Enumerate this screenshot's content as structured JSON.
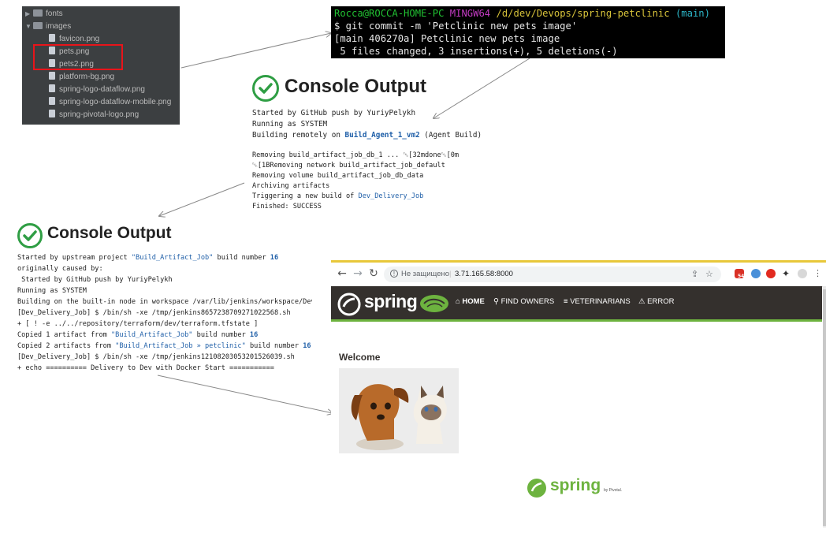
{
  "file_tree": {
    "items": [
      {
        "label": "fonts",
        "type": "folder",
        "expanded": false
      },
      {
        "label": "images",
        "type": "folder",
        "expanded": true
      },
      {
        "label": "favicon.png",
        "type": "file"
      },
      {
        "label": "pets.png",
        "type": "file",
        "highlighted": true
      },
      {
        "label": "pets2.png",
        "type": "file",
        "highlighted": true
      },
      {
        "label": "platform-bg.png",
        "type": "file"
      },
      {
        "label": "spring-logo-dataflow.png",
        "type": "file"
      },
      {
        "label": "spring-logo-dataflow-mobile.png",
        "type": "file"
      },
      {
        "label": "spring-pivotal-logo.png",
        "type": "file"
      }
    ],
    "highlight_color": "#e8141a"
  },
  "terminal": {
    "user_host": "Rocca@ROCCA-HOME-PC",
    "shell": "MINGW64",
    "path": "/d/dev/Devops/spring-petclinic",
    "branch": "(main)",
    "command": "$ git commit -m 'Petclinic new pets image'",
    "out1": "[main 406270a] Petclinic new pets image",
    "out2": " 5 files changed, 3 insertions(+), 5 deletions(-)"
  },
  "console1": {
    "title": "Console Output",
    "l1": "Started by GitHub push by YuriyPelykh",
    "l2": "Running as SYSTEM",
    "l3_pre": "Building remotely on ",
    "l3_link": "Build_Agent_1_vm2",
    "l3_post": " (Agent Build)",
    "l4": "Removing build_artifact_job_db_1 ... ␛[32mdone␛[0m",
    "l5": "␛[1BRemoving network build_artifact_job_default",
    "l6": "Removing volume build_artifact_job_db_data",
    "l7": "Archiving artifacts",
    "l8_pre": "Triggering a new build of ",
    "l8_link": "Dev_Delivery_Job",
    "l9": "Finished: SUCCESS"
  },
  "console2": {
    "title": "Console Output",
    "l1_pre": "Started by upstream project ",
    "l1_link": "\"Build_Artifact_Job\"",
    "l1_mid": " build number ",
    "l1_num": "16",
    "l2": "originally caused by:",
    "l3": " Started by GitHub push by YuriyPelykh",
    "l4": "Running as SYSTEM",
    "l5": "Building on the built-in node in workspace /var/lib/jenkins/workspace/Dev_",
    "l6": "[Dev_Delivery_Job] $ /bin/sh -xe /tmp/jenkins8657238709271022568.sh",
    "l7": "+ [ ! -e ../../repository/terraform/dev/terraform.tfstate ]",
    "l8_pre": "Copied 1 artifact from ",
    "l8_link": "\"Build_Artifact_Job\"",
    "l8_mid": " build number ",
    "l8_num": "16",
    "l9_pre": "Copied 2 artifacts from ",
    "l9_link": "\"Build_Artifact_Job » petclinic\"",
    "l9_mid": " build number ",
    "l9_num": "16",
    "l10": "[Dev_Delivery_Job] $ /bin/sh -xe /tmp/jenkins1210820305320152603​9.sh",
    "l11": "+ echo ========== Delivery to Dev with Docker Start ==========="
  },
  "browser": {
    "not_secure": "Не защищено",
    "address": "3.71.165.58:8000",
    "nav": {
      "home": "HOME",
      "find_owners": "FIND OWNERS",
      "veterinarians": "VETERINARIANS",
      "error": "ERROR"
    },
    "brand": "spring",
    "welcome": "Welcome",
    "footer_brand": "spring",
    "footer_by": "by Pivotal.",
    "mail_badge": "54"
  },
  "colors": {
    "spring_green": "#6db33f",
    "nav_bg": "#34302d",
    "link_blue": "#1f5fa8",
    "success_green": "#2f9e44"
  }
}
